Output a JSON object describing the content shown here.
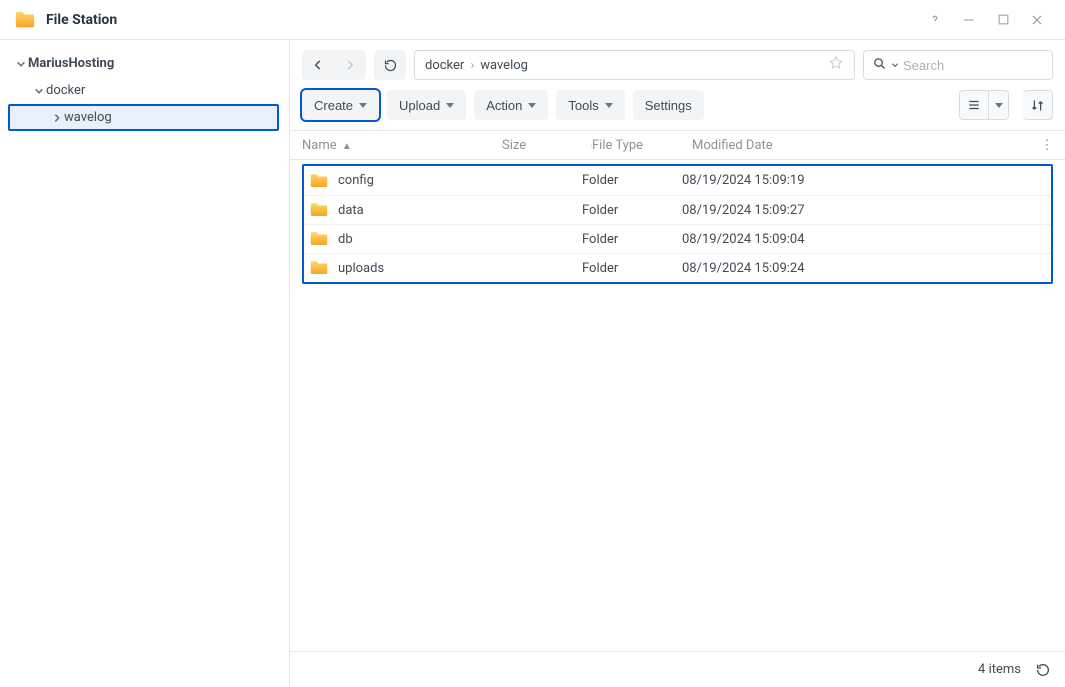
{
  "window": {
    "title": "File Station"
  },
  "sidebar": {
    "root": {
      "label": "MariusHosting"
    },
    "items": [
      {
        "label": "docker",
        "children": [
          {
            "label": "wavelog",
            "selected": true
          }
        ]
      }
    ]
  },
  "breadcrumb": {
    "parts": [
      "docker",
      "wavelog"
    ]
  },
  "search": {
    "placeholder": "Search"
  },
  "toolbar": {
    "create_label": "Create",
    "upload_label": "Upload",
    "action_label": "Action",
    "tools_label": "Tools",
    "settings_label": "Settings"
  },
  "columns": {
    "name": "Name",
    "size": "Size",
    "file_type": "File Type",
    "modified": "Modified Date"
  },
  "rows": [
    {
      "name": "config",
      "size": "",
      "type": "Folder",
      "modified": "08/19/2024 15:09:19"
    },
    {
      "name": "data",
      "size": "",
      "type": "Folder",
      "modified": "08/19/2024 15:09:27"
    },
    {
      "name": "db",
      "size": "",
      "type": "Folder",
      "modified": "08/19/2024 15:09:04"
    },
    {
      "name": "uploads",
      "size": "",
      "type": "Folder",
      "modified": "08/19/2024 15:09:24"
    }
  ],
  "status": {
    "count_label": "4 items"
  }
}
